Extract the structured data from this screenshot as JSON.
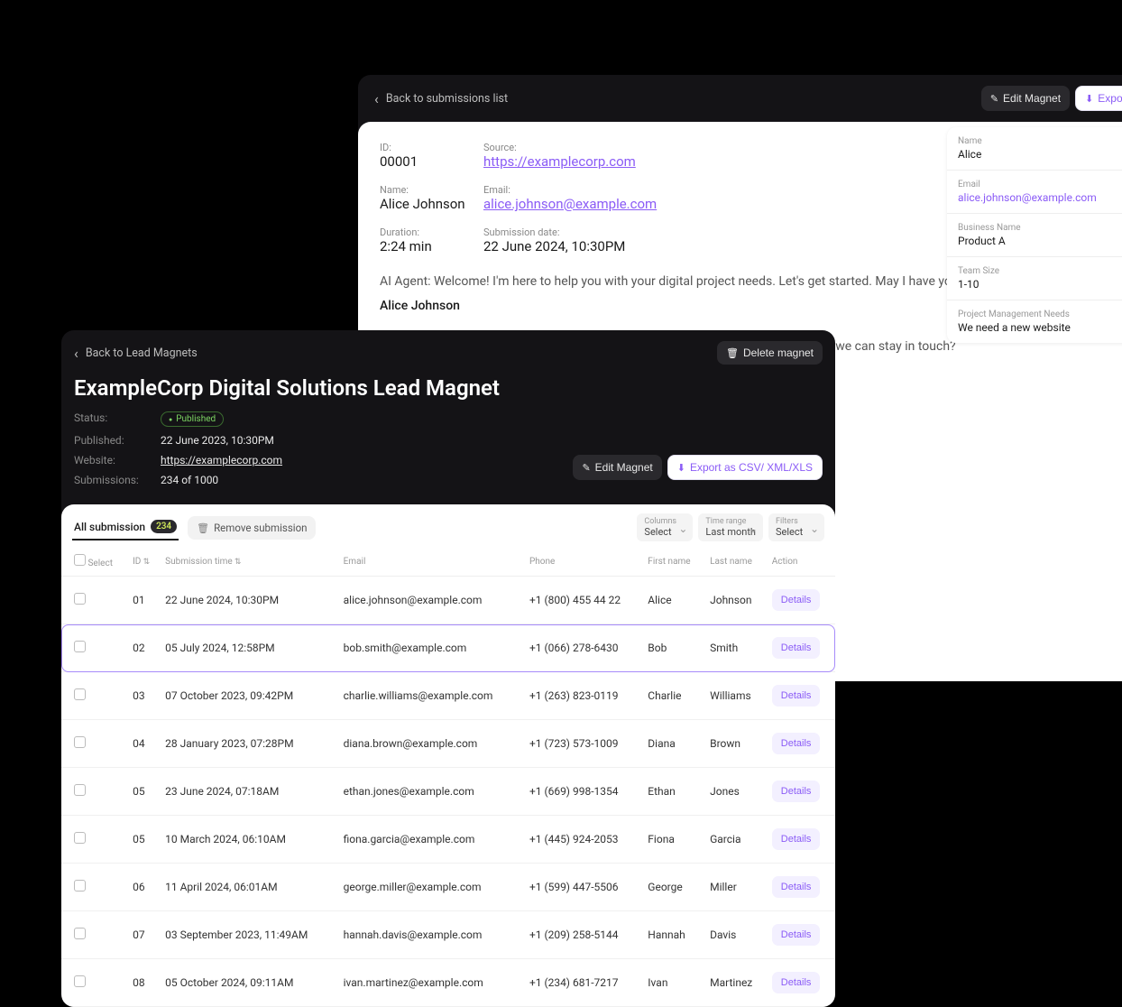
{
  "detail": {
    "back_label": "Back to submissions list",
    "edit_btn": "Edit Magnet",
    "export_btn": "Export as",
    "id_label": "ID:",
    "id_value": "00001",
    "source_label": "Source:",
    "source_value": "https://examplecorp.com",
    "name_label": "Name:",
    "name_value": "Alice Johnson",
    "email_label": "Email:",
    "email_value": "alice.johnson@example.com",
    "duration_label": "Duration:",
    "duration_value": "2:24 min",
    "subdate_label": "Submission date:",
    "subdate_value": "22 June 2024, 10:30PM",
    "conv": [
      "AI Agent: Welcome! I'm here to help you with your digital project needs. Let's get started. May I have your name, please?",
      "Alice Johnson",
      "It's a pleasure to meet you, Alice! Could you please provide your email address so we can stay in touch?"
    ]
  },
  "side": {
    "items": [
      {
        "label": "Name",
        "value": "Alice",
        "purple": false
      },
      {
        "label": "Email",
        "value": "alice.johnson@example.com",
        "purple": true
      },
      {
        "label": "Business Name",
        "value": "Product A",
        "purple": false
      },
      {
        "label": "Team Size",
        "value": "1-10",
        "purple": false
      },
      {
        "label": "Project Management Needs",
        "value": "We need a new website",
        "purple": false
      }
    ]
  },
  "list": {
    "back_label": "Back to Lead Magnets",
    "delete_btn": "Delete magnet",
    "title": "ExampleCorp Digital Solutions Lead Magnet",
    "status_label": "Status:",
    "status_value": "Published",
    "published_label": "Published:",
    "published_value": "22 June 2023, 10:30PM",
    "website_label": "Website:",
    "website_value": "https://examplecorp.com",
    "submissions_label": "Submissions:",
    "submissions_value": "234 of 1000",
    "edit_btn": "Edit Magnet",
    "export_btn": "Export as CSV/ XML/XLS",
    "tab_label": "All submission",
    "tab_count": "234",
    "remove_btn": "Remove submission",
    "filters": [
      {
        "label": "Columns",
        "value": "Select"
      },
      {
        "label": "Time range",
        "value": "Last month"
      },
      {
        "label": "Filters",
        "value": "Select"
      }
    ],
    "columns": {
      "select": "Select",
      "id": "ID",
      "time": "Submission time",
      "email": "Email",
      "phone": "Phone",
      "first": "First name",
      "last": "Last name",
      "action": "Action"
    },
    "details_label": "Details",
    "rows": [
      {
        "id": "01",
        "time": "22 June 2024, 10:30PM",
        "email": "alice.johnson@example.com",
        "phone": "+1 (800) 455 44 22",
        "first": "Alice",
        "last": "Johnson"
      },
      {
        "id": "02",
        "time": "05 July 2024, 12:58PM",
        "email": "bob.smith@example.com",
        "phone": "+1 (066) 278-6430",
        "first": "Bob",
        "last": "Smith",
        "highlighted": true
      },
      {
        "id": "03",
        "time": "07 October 2023, 09:42PM",
        "email": "charlie.williams@example.com",
        "phone": "+1 (263) 823-0119",
        "first": "Charlie",
        "last": "Williams"
      },
      {
        "id": "04",
        "time": "28 January 2023, 07:28PM",
        "email": "diana.brown@example.com",
        "phone": "+1 (723) 573-1009",
        "first": "Diana",
        "last": "Brown"
      },
      {
        "id": "05",
        "time": "23 June 2024, 07:18AM",
        "email": "ethan.jones@example.com",
        "phone": "+1 (669) 998-1354",
        "first": "Ethan",
        "last": "Jones"
      },
      {
        "id": "05",
        "time": "10 March 2024, 06:10AM",
        "email": "fiona.garcia@example.com",
        "phone": "+1 (445) 924-2053",
        "first": "Fiona",
        "last": "Garcia"
      },
      {
        "id": "06",
        "time": "11 April 2024, 06:01AM",
        "email": "george.miller@example.com",
        "phone": "+1 (599) 447-5506",
        "first": "George",
        "last": "Miller"
      },
      {
        "id": "07",
        "time": "03 September 2023, 11:49AM",
        "email": "hannah.davis@example.com",
        "phone": "+1 (209) 258-5144",
        "first": "Hannah",
        "last": "Davis"
      },
      {
        "id": "08",
        "time": "05 October 2024, 09:11AM",
        "email": "ivan.martinez@example.com",
        "phone": "+1 (234) 681-7217",
        "first": "Ivan",
        "last": "Martinez"
      }
    ]
  }
}
